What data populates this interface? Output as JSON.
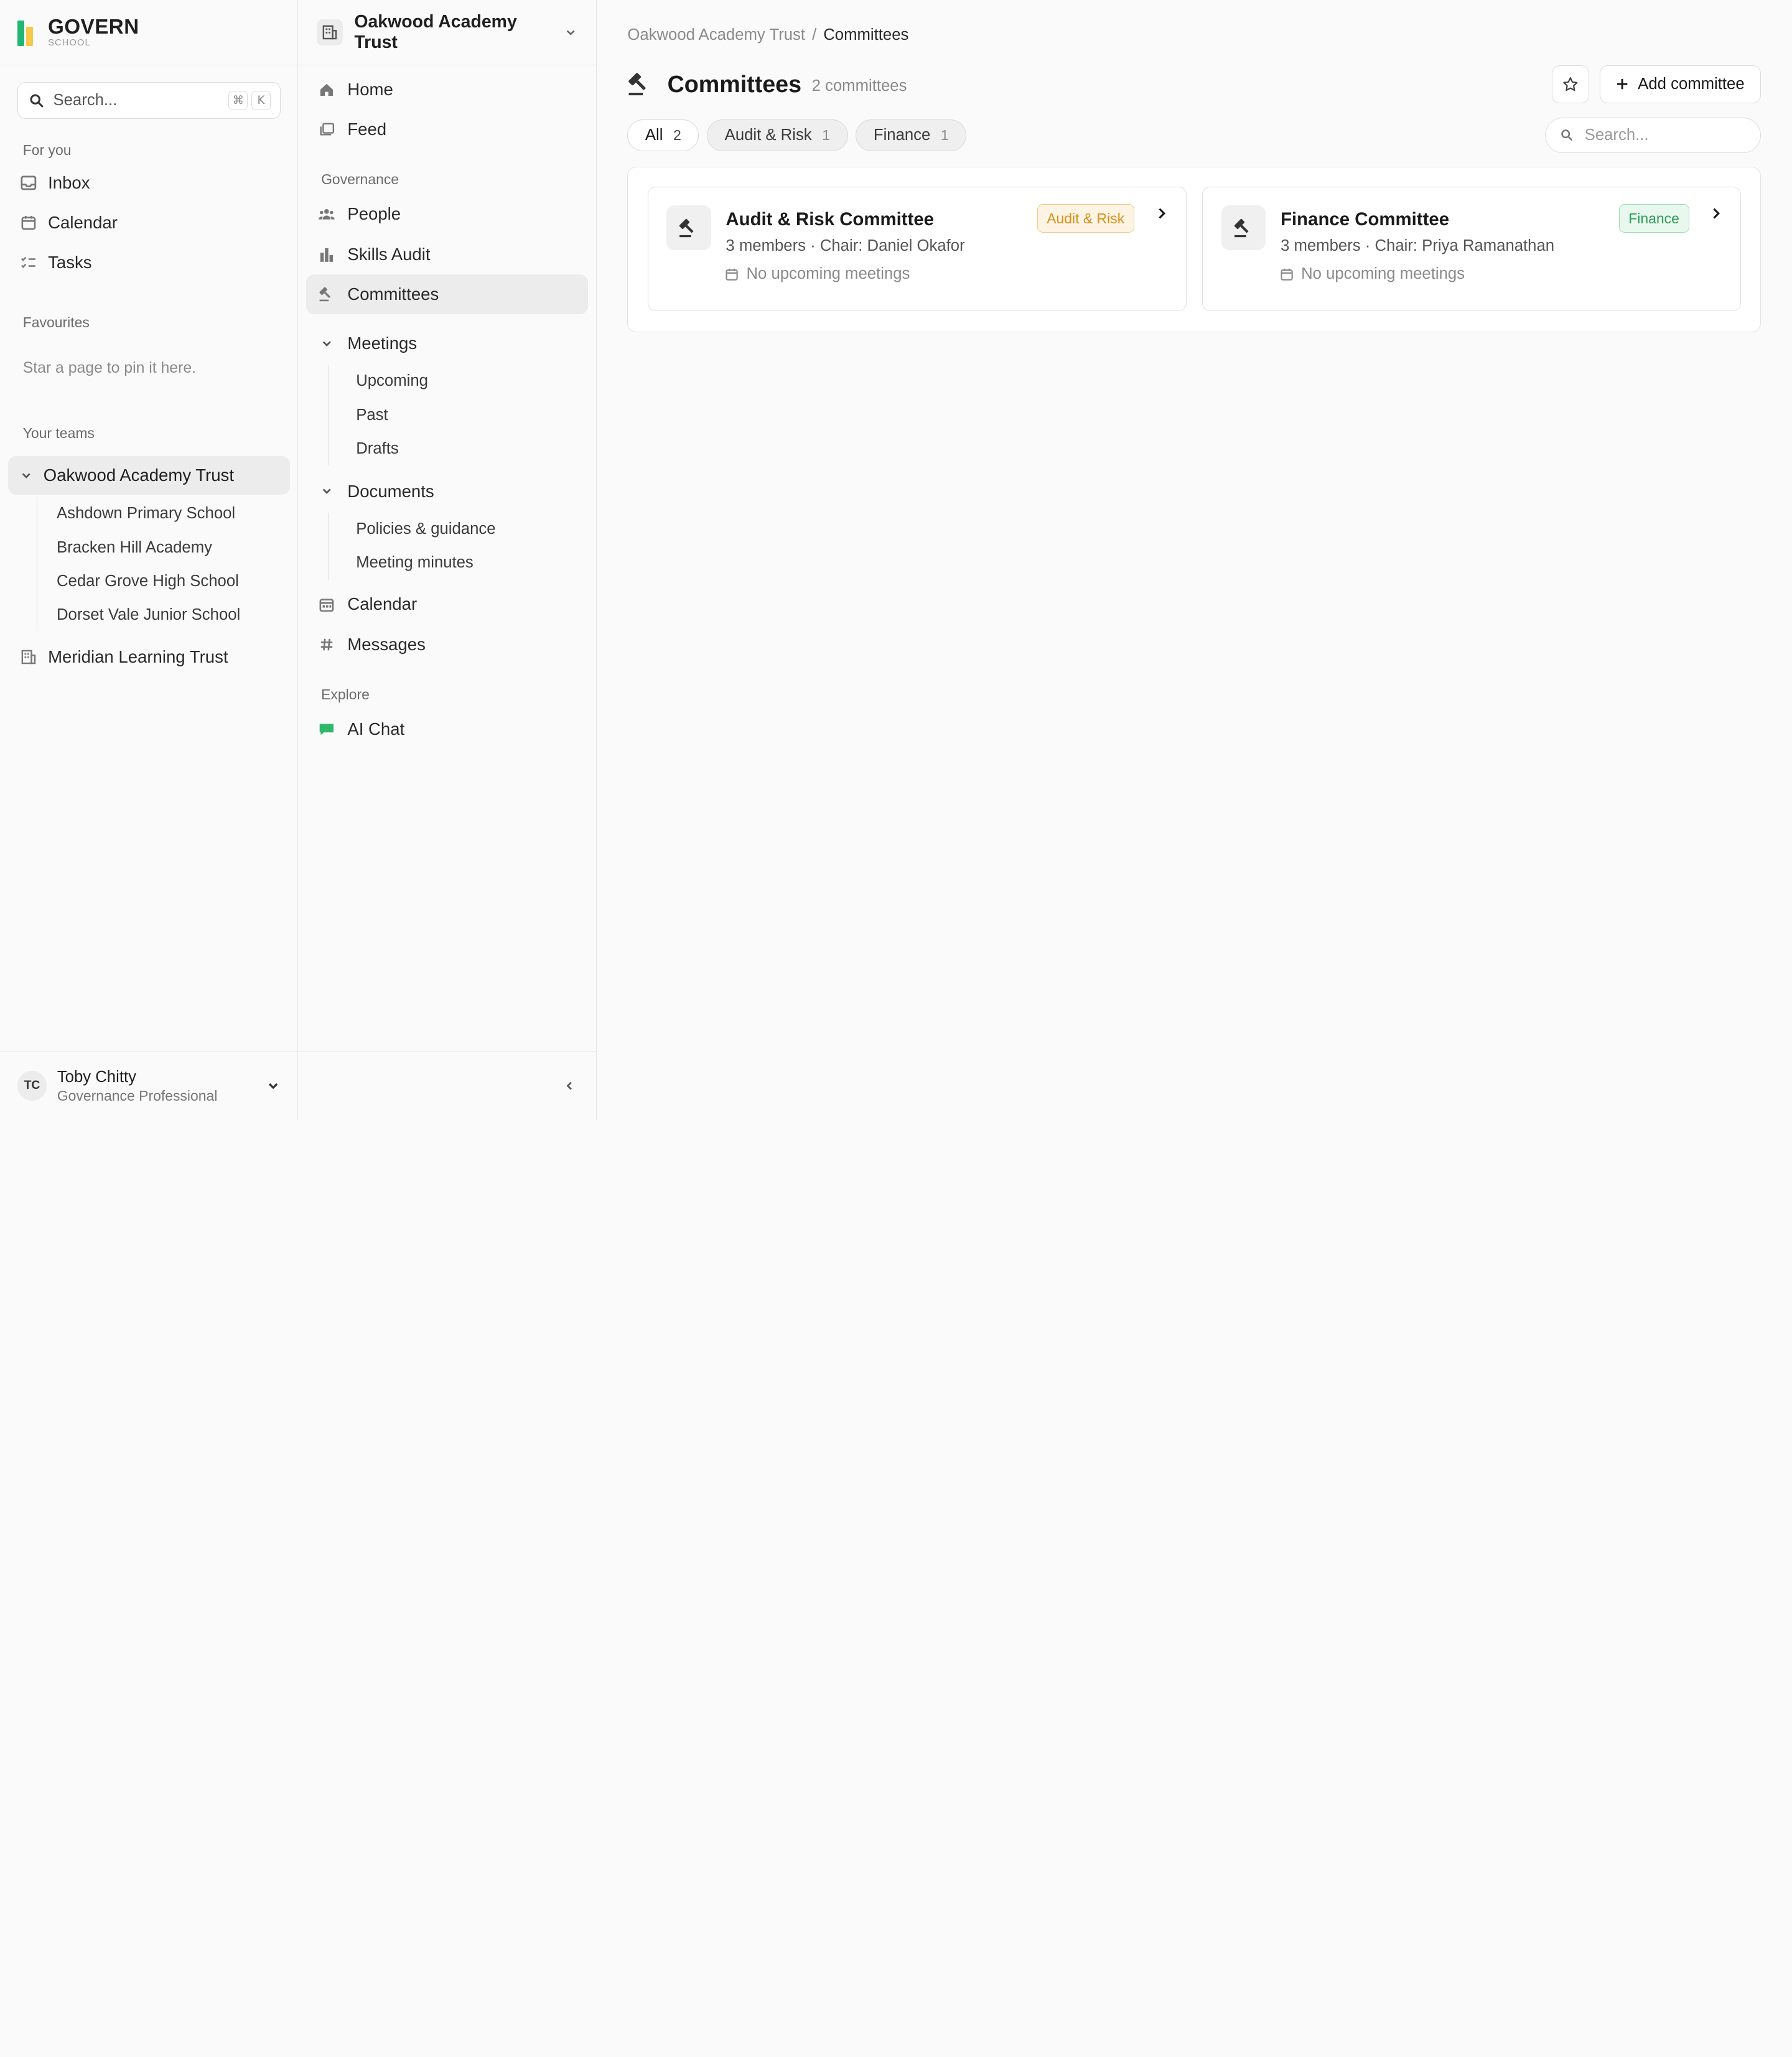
{
  "brand": {
    "name": "GOVERN",
    "sub": "SCHOOL",
    "colors": [
      "#22b573",
      "#f7c948",
      "#2a8ad8"
    ]
  },
  "sidebar": {
    "search_placeholder": "Search...",
    "shortcut_keys": [
      "⌘",
      "K"
    ],
    "for_you_label": "For you",
    "for_you_items": [
      {
        "label": "Inbox",
        "icon": "inbox-icon"
      },
      {
        "label": "Calendar",
        "icon": "calendar-icon"
      },
      {
        "label": "Tasks",
        "icon": "checklist-icon"
      }
    ],
    "favourites_label": "Favourites",
    "favourites_empty": "Star a page to pin it here.",
    "teams_label": "Your teams",
    "active_team": "Oakwood Academy Trust",
    "schools": [
      "Ashdown Primary School",
      "Bracken Hill Academy",
      "Cedar Grove High School",
      "Dorset Vale Junior School"
    ],
    "other_team": "Meridian Learning Trust",
    "user": {
      "initials": "TC",
      "name": "Toby Chitty",
      "role": "Governance Professional"
    }
  },
  "subnav": {
    "org_name": "Oakwood Academy Trust",
    "top_items": [
      {
        "label": "Home",
        "icon": "home-icon"
      },
      {
        "label": "Feed",
        "icon": "feed-icon"
      }
    ],
    "governance_label": "Governance",
    "governance_items": [
      {
        "label": "People",
        "icon": "people-icon"
      },
      {
        "label": "Skills Audit",
        "icon": "bar-chart-icon"
      },
      {
        "label": "Committees",
        "icon": "gavel-icon",
        "active": true
      }
    ],
    "meetings_label": "Meetings",
    "meetings_items": [
      "Upcoming",
      "Past",
      "Drafts"
    ],
    "documents_label": "Documents",
    "documents_items": [
      "Policies & guidance",
      "Meeting minutes"
    ],
    "calendar_label": "Calendar",
    "messages_label": "Messages",
    "explore_label": "Explore",
    "ai_chat_label": "AI Chat"
  },
  "main": {
    "breadcrumb": [
      "Oakwood Academy Trust",
      "Committees"
    ],
    "breadcrumb_sep": "/",
    "title": "Committees",
    "count_text": "2 committees",
    "add_button": "Add committee",
    "filters": [
      {
        "label": "All",
        "count": "2",
        "active": true
      },
      {
        "label": "Audit & Risk",
        "count": "1",
        "active": false
      },
      {
        "label": "Finance",
        "count": "1",
        "active": false
      }
    ],
    "search_placeholder": "Search...",
    "committees": [
      {
        "title": "Audit & Risk Committee",
        "meta": "3 members · Chair: Daniel Okafor",
        "meetings": "No upcoming meetings",
        "badge": "Audit & Risk",
        "badge_color": "#d9901c"
      },
      {
        "title": "Finance Committee",
        "meta": "3 members · Chair: Priya Ramanathan",
        "meetings": "No upcoming meetings",
        "badge": "Finance",
        "badge_color": "#2e9c59"
      }
    ]
  }
}
